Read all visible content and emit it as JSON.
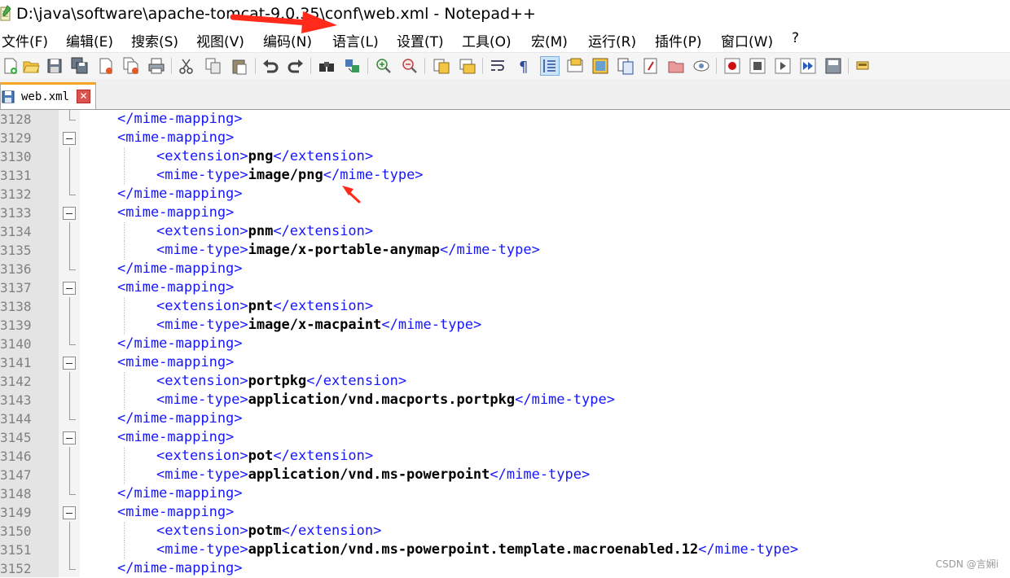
{
  "window": {
    "title": "D:\\java\\software\\apache-tomcat-9.0.35\\conf\\web.xml - Notepad++",
    "app_icon": "notepad-icon"
  },
  "menu": [
    "文件(F)",
    "编辑(E)",
    "搜索(S)",
    "视图(V)",
    "编码(N)",
    "语言(L)",
    "设置(T)",
    "工具(O)",
    "宏(M)",
    "运行(R)",
    "插件(P)",
    "窗口(W)",
    "?"
  ],
  "tab": {
    "label": "web.xml",
    "close": "✕"
  },
  "lines": [
    {
      "num": "3128",
      "indent": 2,
      "parts": [
        [
          "tag",
          "</mime-mapping>"
        ]
      ]
    },
    {
      "num": "3129",
      "indent": 2,
      "parts": [
        [
          "tag",
          "<mime-mapping>"
        ]
      ]
    },
    {
      "num": "3130",
      "indent": 4,
      "parts": [
        [
          "tag",
          "<extension>"
        ],
        [
          "val",
          "png"
        ],
        [
          "tag",
          "</extension>"
        ]
      ]
    },
    {
      "num": "3131",
      "indent": 4,
      "parts": [
        [
          "tag",
          "<mime-type>"
        ],
        [
          "val",
          "image/png"
        ],
        [
          "tag",
          "</mime-type>"
        ]
      ]
    },
    {
      "num": "3132",
      "indent": 2,
      "parts": [
        [
          "tag",
          "</mime-mapping>"
        ]
      ]
    },
    {
      "num": "3133",
      "indent": 2,
      "parts": [
        [
          "tag",
          "<mime-mapping>"
        ]
      ]
    },
    {
      "num": "3134",
      "indent": 4,
      "parts": [
        [
          "tag",
          "<extension>"
        ],
        [
          "val",
          "pnm"
        ],
        [
          "tag",
          "</extension>"
        ]
      ]
    },
    {
      "num": "3135",
      "indent": 4,
      "parts": [
        [
          "tag",
          "<mime-type>"
        ],
        [
          "val",
          "image/x-portable-anymap"
        ],
        [
          "tag",
          "</mime-type>"
        ]
      ]
    },
    {
      "num": "3136",
      "indent": 2,
      "parts": [
        [
          "tag",
          "</mime-mapping>"
        ]
      ]
    },
    {
      "num": "3137",
      "indent": 2,
      "parts": [
        [
          "tag",
          "<mime-mapping>"
        ]
      ]
    },
    {
      "num": "3138",
      "indent": 4,
      "parts": [
        [
          "tag",
          "<extension>"
        ],
        [
          "val",
          "pnt"
        ],
        [
          "tag",
          "</extension>"
        ]
      ]
    },
    {
      "num": "3139",
      "indent": 4,
      "parts": [
        [
          "tag",
          "<mime-type>"
        ],
        [
          "val",
          "image/x-macpaint"
        ],
        [
          "tag",
          "</mime-type>"
        ]
      ]
    },
    {
      "num": "3140",
      "indent": 2,
      "parts": [
        [
          "tag",
          "</mime-mapping>"
        ]
      ]
    },
    {
      "num": "3141",
      "indent": 2,
      "parts": [
        [
          "tag",
          "<mime-mapping>"
        ]
      ]
    },
    {
      "num": "3142",
      "indent": 4,
      "parts": [
        [
          "tag",
          "<extension>"
        ],
        [
          "val",
          "portpkg"
        ],
        [
          "tag",
          "</extension>"
        ]
      ]
    },
    {
      "num": "3143",
      "indent": 4,
      "parts": [
        [
          "tag",
          "<mime-type>"
        ],
        [
          "val",
          "application/vnd.macports.portpkg"
        ],
        [
          "tag",
          "</mime-type>"
        ]
      ]
    },
    {
      "num": "3144",
      "indent": 2,
      "parts": [
        [
          "tag",
          "</mime-mapping>"
        ]
      ]
    },
    {
      "num": "3145",
      "indent": 2,
      "parts": [
        [
          "tag",
          "<mime-mapping>"
        ]
      ]
    },
    {
      "num": "3146",
      "indent": 4,
      "parts": [
        [
          "tag",
          "<extension>"
        ],
        [
          "val",
          "pot"
        ],
        [
          "tag",
          "</extension>"
        ]
      ]
    },
    {
      "num": "3147",
      "indent": 4,
      "parts": [
        [
          "tag",
          "<mime-type>"
        ],
        [
          "val",
          "application/vnd.ms-powerpoint"
        ],
        [
          "tag",
          "</mime-type>"
        ]
      ]
    },
    {
      "num": "3148",
      "indent": 2,
      "parts": [
        [
          "tag",
          "</mime-mapping>"
        ]
      ]
    },
    {
      "num": "3149",
      "indent": 2,
      "parts": [
        [
          "tag",
          "<mime-mapping>"
        ]
      ]
    },
    {
      "num": "3150",
      "indent": 4,
      "parts": [
        [
          "tag",
          "<extension>"
        ],
        [
          "val",
          "potm"
        ],
        [
          "tag",
          "</extension>"
        ]
      ]
    },
    {
      "num": "3151",
      "indent": 4,
      "parts": [
        [
          "tag",
          "<mime-type>"
        ],
        [
          "val",
          "application/vnd.ms-powerpoint.template.macroenabled.12"
        ],
        [
          "tag",
          "</mime-type>"
        ]
      ]
    },
    {
      "num": "3152",
      "indent": 2,
      "parts": [
        [
          "tag",
          "</mime-mapping>"
        ]
      ]
    }
  ],
  "watermark": "CSDN @言娴i",
  "colors": {
    "tag": "#1515ff",
    "value": "#000000",
    "annotation_arrow": "#ff2a1a",
    "tab_accent": "#f6a623"
  }
}
